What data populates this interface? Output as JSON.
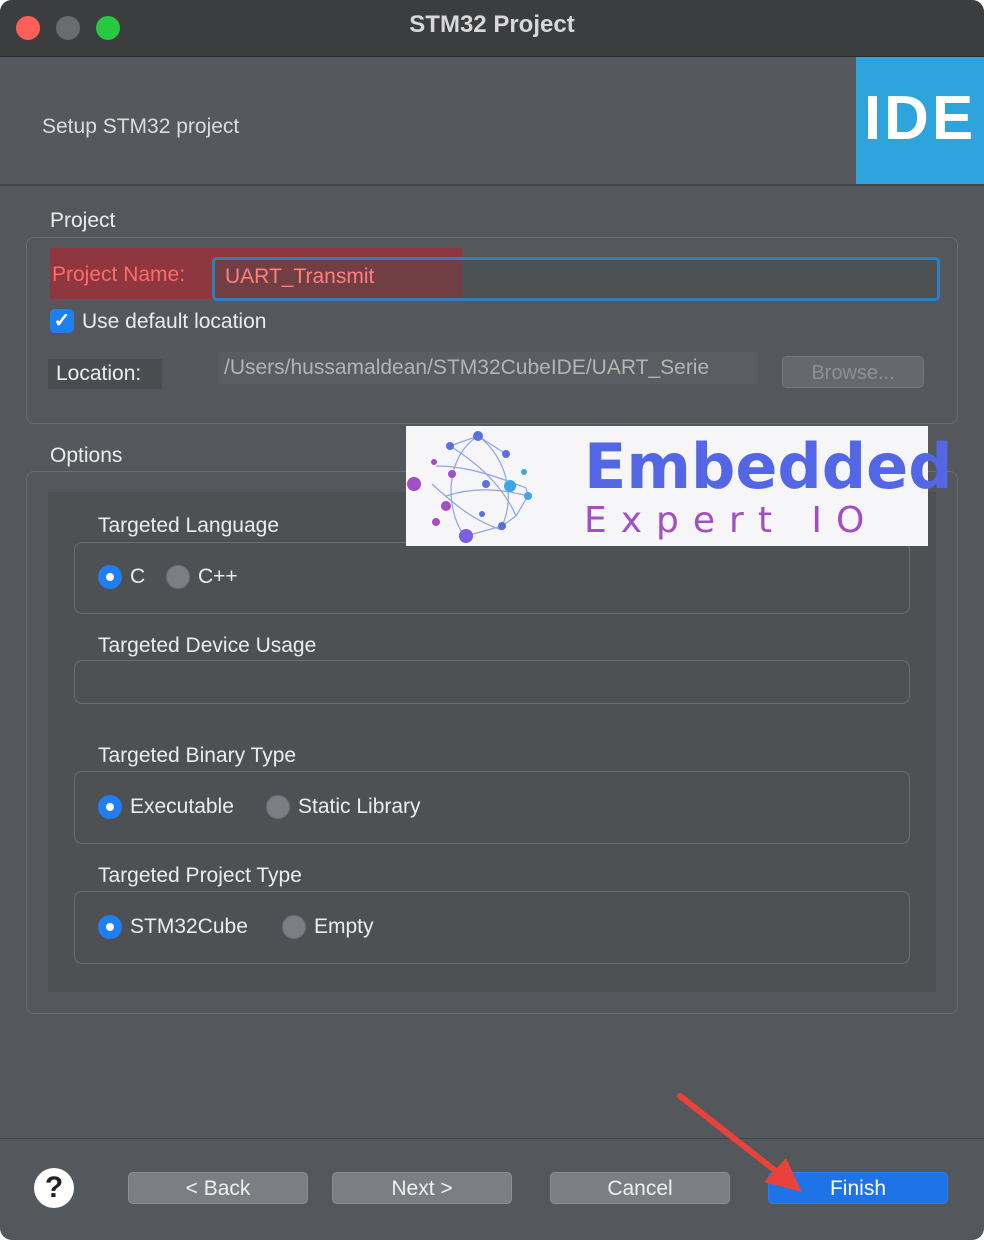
{
  "window": {
    "title": "STM32 Project"
  },
  "header": {
    "subtitle": "Setup STM32 project",
    "badge": "IDE"
  },
  "project": {
    "group_label": "Project",
    "name_label": "Project Name:",
    "name_value": "UART_Transmit",
    "default_location_label": "Use default location",
    "default_location_checked": true,
    "location_label": "Location:",
    "location_value": "/Users/hussamaldean/STM32CubeIDE/UART_Serie",
    "browse_label": "Browse..."
  },
  "options": {
    "group_label": "Options",
    "language": {
      "label": "Targeted Language",
      "options": [
        "C",
        "C++"
      ],
      "selected": "C"
    },
    "device_usage": {
      "label": "Targeted Device Usage"
    },
    "binary": {
      "label": "Targeted Binary Type",
      "options": [
        "Executable",
        "Static Library"
      ],
      "selected": "Executable"
    },
    "project_type": {
      "label": "Targeted Project Type",
      "options": [
        "STM32Cube",
        "Empty"
      ],
      "selected": "STM32Cube"
    }
  },
  "logo": {
    "line1": "Embedded",
    "line2": "Expert IO"
  },
  "footer": {
    "help": "?",
    "back_label": "< Back",
    "next_label": "Next >",
    "cancel_label": "Cancel",
    "finish_label": "Finish"
  },
  "colors": {
    "accent": "#1f7ff2",
    "ide_badge": "#2fa4dc",
    "annotation": "#e8423a"
  }
}
